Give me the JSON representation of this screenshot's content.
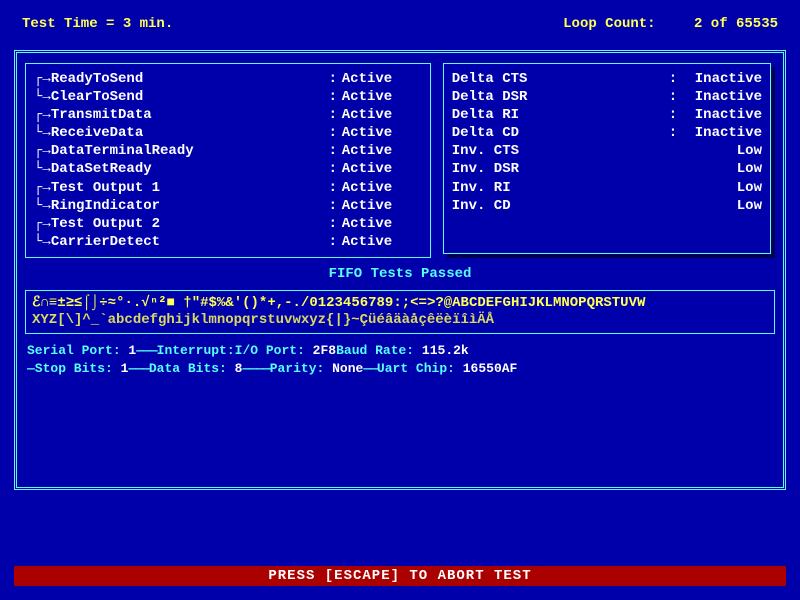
{
  "header": {
    "test_time_label": "Test Time = 3 min.",
    "loop_count_label": "Loop Count:",
    "loop_count_value": "2 of 65535"
  },
  "signals_left": [
    {
      "pair_start": true,
      "arrow": "┌→",
      "name": "ReadyToSend",
      "sep": ":",
      "value": "Active"
    },
    {
      "pair_end": true,
      "arrow": "└→",
      "name": "ClearToSend",
      "sep": ":",
      "value": "Active"
    },
    {
      "pair_start": true,
      "arrow": "┌→",
      "name": "TransmitData",
      "sep": ":",
      "value": "Active"
    },
    {
      "pair_end": true,
      "arrow": "└→",
      "name": "ReceiveData",
      "sep": ":",
      "value": "Active"
    },
    {
      "pair_start": true,
      "arrow": "┌→",
      "name": "DataTerminalReady",
      "sep": ":",
      "value": "Active"
    },
    {
      "pair_end": true,
      "arrow": "└→",
      "name": "DataSetReady",
      "sep": ":",
      "value": "Active"
    },
    {
      "pair_start": true,
      "arrow": "┌→",
      "name": "Test Output 1",
      "sep": ":",
      "value": "Active"
    },
    {
      "pair_end": true,
      "arrow": "└→",
      "name": "RingIndicator",
      "sep": ":",
      "value": "Active"
    },
    {
      "pair_start": true,
      "arrow": "┌→",
      "name": "Test Output 2",
      "sep": ":",
      "value": "Active"
    },
    {
      "pair_end": true,
      "arrow": "└→",
      "name": "CarrierDetect",
      "sep": ":",
      "value": "Active"
    }
  ],
  "signals_right": [
    {
      "name": "Delta CTS",
      "sep": ":",
      "value": "Inactive"
    },
    {
      "name": "Delta DSR",
      "sep": ":",
      "value": "Inactive"
    },
    {
      "name": "Delta RI",
      "sep": ":",
      "value": "Inactive"
    },
    {
      "name": "Delta CD",
      "sep": ":",
      "value": "Inactive"
    },
    {
      "name": "Inv. CTS",
      "sep": "",
      "value": "Low"
    },
    {
      "name": "Inv. DSR",
      "sep": "",
      "value": "Low"
    },
    {
      "name": "Inv. RI",
      "sep": "",
      "value": "Low"
    },
    {
      "name": "Inv. CD",
      "sep": "",
      "value": "Low"
    }
  ],
  "fifo_status": "FIFO Tests Passed",
  "ascii_stream": {
    "line1": "ℰ∩≡±≥≤⌠⌡÷≈°·.√ⁿ²■  †\"#$%&'()*+,-./0123456789:;<=>?@ABCDEFGHIJKLMNOPQRSTUVW",
    "line2": "XYZ[\\]^_`abcdefghijklmnopqrstuvwxyz{|}~ÇüéâäàåçêëèïîìÄÅ"
  },
  "config": {
    "row1": [
      {
        "label": "Serial Port:",
        "value": " 1",
        "dash": "———"
      },
      {
        "label": "Interrupt:",
        "value": "",
        "dash": ""
      },
      {
        "label": "     I/O Port:",
        "value": "  2F8",
        "dash": "   "
      },
      {
        "label": "Baud Rate:",
        "value": " 115.2k",
        "dash": ""
      }
    ],
    "row2": [
      {
        "label": "—Stop Bits:",
        "value": " 1",
        "dash": "———"
      },
      {
        "label": "Data Bits:",
        "value": "  8",
        "dash": "————"
      },
      {
        "label": "Parity:",
        "value": " None",
        "dash": "——"
      },
      {
        "label": "Uart Chip:",
        "value": " 16550AF",
        "dash": ""
      }
    ]
  },
  "footer": "PRESS [ESCAPE] TO ABORT TEST"
}
